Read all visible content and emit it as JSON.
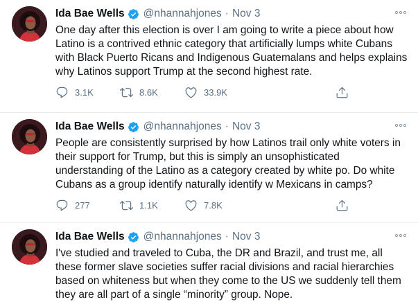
{
  "tweets": [
    {
      "author_name": "Ida Bae Wells",
      "handle": "@nhannahjones",
      "separator": "·",
      "date": "Nov 3",
      "text": "One day after this election is over I am going to write a piece about how Latino is a contrived ethnic category that artificially lumps white Cubans with Black Puerto Ricans and Indigenous Guatemalans and helps explains why Latinos support Trump at the second highest rate.",
      "replies": "3.1K",
      "retweets": "8.6K",
      "likes": "33.9K"
    },
    {
      "author_name": "Ida Bae Wells",
      "handle": "@nhannahjones",
      "separator": "·",
      "date": "Nov 3",
      "text": "People are consistently surprised by how Latinos trail only white voters in their support for Trump, but this is simply an unsophisticated understanding of the Latino as a category created by white po. Do white Cubans as a group identify naturally identify w Mexicans in camps?",
      "replies": "277",
      "retweets": "1.1K",
      "likes": "7.8K"
    },
    {
      "author_name": "Ida Bae Wells",
      "handle": "@nhannahjones",
      "separator": "·",
      "date": "Nov 3",
      "text": "I've studied and traveled to Cuba, the DR and Brazil, and trust me, all these former slave societies suffer racial divisions and racial hierarchies based on whiteness but when they come to the US we suddenly tell them they are all part of a single “minority” group. Nope."
    }
  ],
  "colors": {
    "verified": "#1da1f2",
    "secondary_text": "#5b7083",
    "divider": "#e6ecf0"
  },
  "icons": [
    "verified-badge-icon",
    "more-icon",
    "reply-icon",
    "retweet-icon",
    "like-icon",
    "share-icon"
  ]
}
